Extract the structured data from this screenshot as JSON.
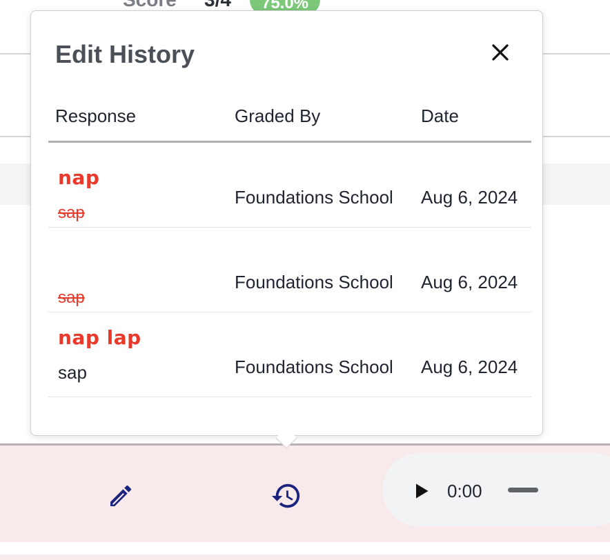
{
  "background": {
    "score_label": "Score",
    "score_fraction": "3/4",
    "score_percent": "75.0%"
  },
  "modal": {
    "title": "Edit History",
    "columns": {
      "response": "Response",
      "graded_by": "Graded By",
      "date": "Date"
    },
    "rows": [
      {
        "response_handwritten": "nap",
        "response_struck": "sap",
        "response_plain": "",
        "graded_by": "Foundations School",
        "date": "Aug 6, 2024"
      },
      {
        "response_handwritten": "",
        "response_struck": "sap",
        "response_plain": "",
        "graded_by": "Foundations School",
        "date": "Aug 6, 2024"
      },
      {
        "response_handwritten": "nap lap",
        "response_struck": "",
        "response_plain": "sap",
        "graded_by": "Foundations School",
        "date": "Aug 6, 2024"
      }
    ]
  },
  "audio": {
    "time": "0:00"
  },
  "icons": {
    "close": "close-icon",
    "edit": "pencil-icon",
    "history": "history-icon",
    "play": "play-icon"
  },
  "colors": {
    "accent_icon": "#1a237e",
    "mark_red": "#e8392b",
    "bottom_bar": "#f8e9ea",
    "score_badge": "#7cc97a"
  }
}
